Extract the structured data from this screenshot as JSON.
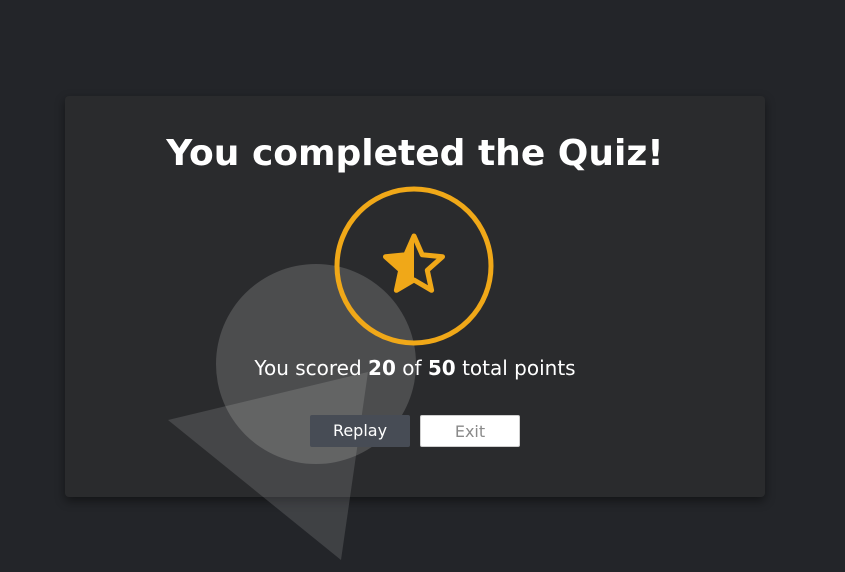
{
  "quiz": {
    "title": "You completed the Quiz!",
    "score_prefix": "You scored",
    "score_value": "20",
    "score_of": "of",
    "score_total": "50",
    "score_suffix": "total points",
    "badge_icon": "star-half-icon",
    "accent_color": "#f0a818"
  },
  "actions": {
    "replay_label": "Replay",
    "exit_label": "Exit"
  }
}
